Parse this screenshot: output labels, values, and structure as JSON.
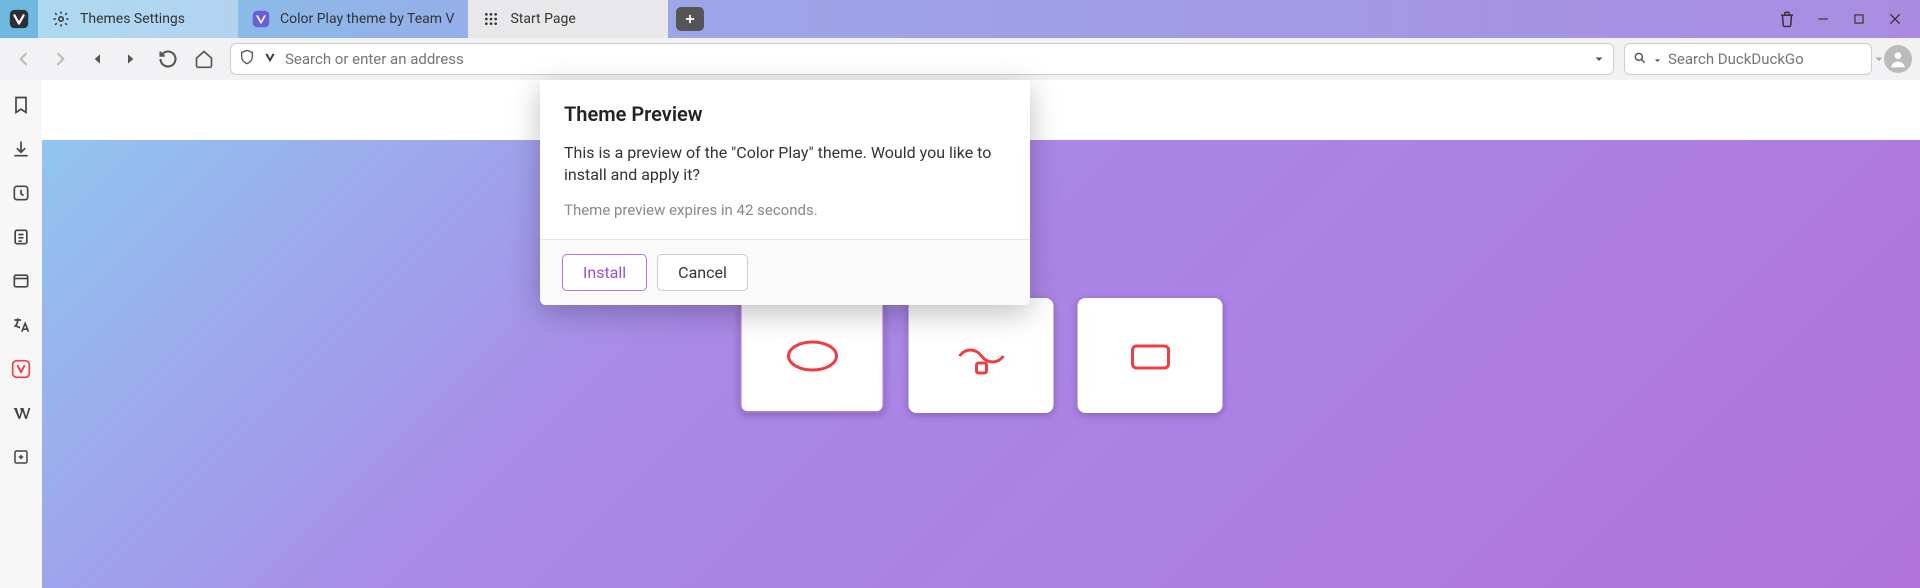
{
  "tabs": [
    {
      "label": "Themes Settings"
    },
    {
      "label": "Color Play theme by Team V"
    },
    {
      "label": "Start Page"
    }
  ],
  "toolbar": {
    "address_placeholder": "Search or enter an address",
    "search_placeholder": "Search DuckDuckGo"
  },
  "modal": {
    "title": "Theme Preview",
    "message": "This is a preview of the \"Color Play\" theme. Would you like to install and apply it?",
    "expires": "Theme preview expires in 42 seconds.",
    "install_label": "Install",
    "cancel_label": "Cancel"
  }
}
